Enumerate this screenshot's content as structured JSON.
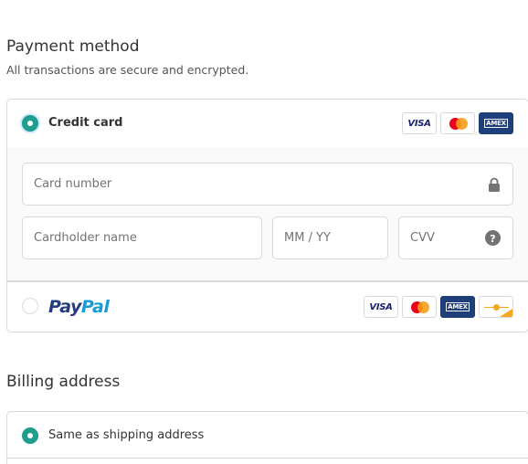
{
  "payment": {
    "heading": "Payment method",
    "subheading": "All transactions are secure and encrypted.",
    "credit_card": {
      "label": "Credit card",
      "selected": true,
      "card_icons": [
        "visa-icon",
        "mastercard-icon",
        "amex-icon"
      ],
      "visa_text": "VISA",
      "amex_text": "AMEX",
      "fields": {
        "card_number_placeholder": "Card number",
        "cardholder_placeholder": "Cardholder name",
        "expiry_placeholder": "MM / YY",
        "cvv_placeholder": "CVV"
      }
    },
    "paypal": {
      "label_part1": "Pay",
      "label_part2": "Pal",
      "selected": false,
      "card_icons": [
        "visa-icon",
        "mastercard-icon",
        "amex-icon",
        "discover-icon"
      ],
      "visa_text": "VISA",
      "amex_text": "AMEX"
    }
  },
  "billing": {
    "heading": "Billing address",
    "same_as_shipping_label": "Same as shipping address",
    "same_as_shipping_selected": true
  },
  "colors": {
    "accent": "#1f9e8e",
    "border": "#d9d9d9",
    "panel_bg": "#fafafa",
    "paypal_dark": "#253b80",
    "paypal_light": "#179bd7"
  }
}
